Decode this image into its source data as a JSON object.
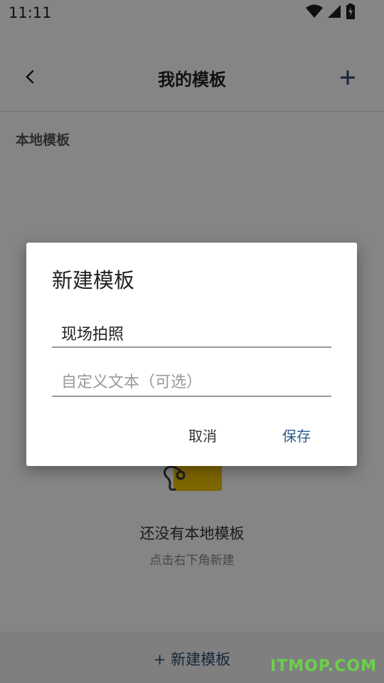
{
  "status_bar": {
    "time": "11:11"
  },
  "header": {
    "title": "我的模板"
  },
  "section": {
    "label": "本地模板"
  },
  "empty_state": {
    "title": "还没有本地模板",
    "hint": "点击右下角新建"
  },
  "bottom_bar": {
    "add_label": "+ 新建模板"
  },
  "watermark": {
    "text": "ITMOP.COM"
  },
  "dialog": {
    "title": "新建模板",
    "name_value": "现场拍照",
    "custom_placeholder": "自定义文本（可选）",
    "cancel_label": "取消",
    "save_label": "保存"
  },
  "colors": {
    "accent": "#2b5a8c",
    "tag_yellow": "#f2c400",
    "watermark_green": "#6bd04a"
  }
}
